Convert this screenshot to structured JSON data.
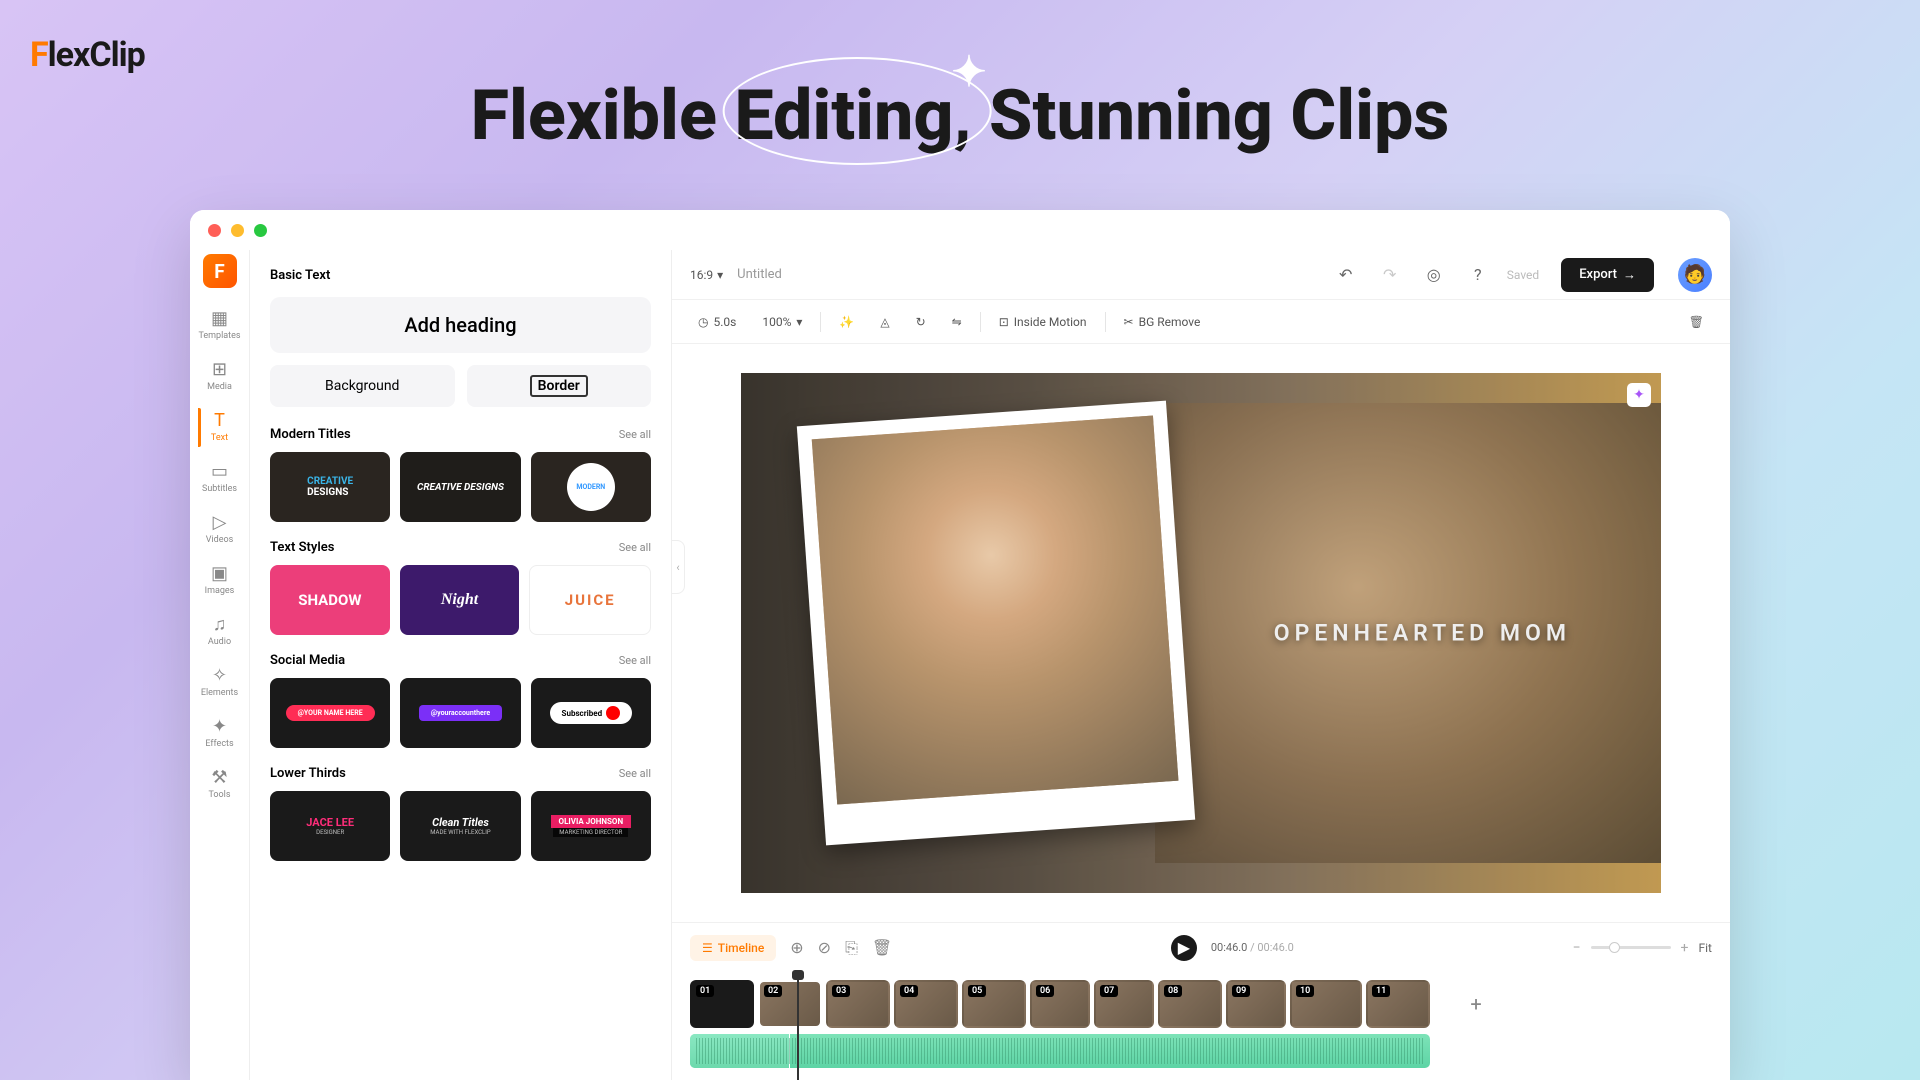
{
  "brand": "FlexClip",
  "hero": {
    "pre": "Flexible ",
    "em": "Editing,",
    "post": " Stunning Clips"
  },
  "side_nav": [
    {
      "key": "templates",
      "label": "Templates",
      "icon": "▦"
    },
    {
      "key": "media",
      "label": "Media",
      "icon": "⊞"
    },
    {
      "key": "text",
      "label": "Text",
      "icon": "T",
      "active": true
    },
    {
      "key": "subtitles",
      "label": "Subtitles",
      "icon": "▭"
    },
    {
      "key": "videos",
      "label": "Videos",
      "icon": "▷"
    },
    {
      "key": "images",
      "label": "Images",
      "icon": "▣"
    },
    {
      "key": "audio",
      "label": "Audio",
      "icon": "♫"
    },
    {
      "key": "elements",
      "label": "Elements",
      "icon": "✧"
    },
    {
      "key": "effects",
      "label": "Effects",
      "icon": "✦"
    },
    {
      "key": "tools",
      "label": "Tools",
      "icon": "⚒"
    }
  ],
  "panel": {
    "title": "Basic Text",
    "add_heading": "Add heading",
    "background": "Background",
    "border": "Border",
    "sections": {
      "modern": {
        "name": "Modern Titles",
        "see_all": "See all",
        "t1a": "CREATIVE",
        "t1b": "DESIGNS",
        "t2": "CREATIVE DESIGNS",
        "t3": "MODERN"
      },
      "styles": {
        "name": "Text Styles",
        "see_all": "See all",
        "t1": "SHADOW",
        "t2": "Night",
        "t3": "JUICE"
      },
      "social": {
        "name": "Social Media",
        "see_all": "See all",
        "t1": "@YOUR NAME HERE",
        "t2": "@youraccounthere",
        "t3": "Subscribed"
      },
      "lower": {
        "name": "Lower Thirds",
        "see_all": "See all",
        "t1n": "JACE LEE",
        "t1s": "DESIGNER",
        "t2n": "Clean Titles",
        "t2s": "MADE WITH FLEXCLIP",
        "t3n": "OLIVIA JOHNSON",
        "t3s": "MARKETING DIRECTOR"
      }
    }
  },
  "top": {
    "ratio": "16:9",
    "project": "Untitled",
    "saved": "Saved",
    "export": "Export"
  },
  "tools": {
    "duration": "5.0s",
    "zoom": "100%",
    "inside_motion": "Inside Motion",
    "bg_remove": "BG Remove"
  },
  "canvas_text": "OPENHEARTED MOM",
  "timeline": {
    "label": "Timeline",
    "current": "00:46.0",
    "total": "/ 00:46.0",
    "fit": "Fit",
    "clips": [
      "01",
      "02",
      "03",
      "04",
      "05",
      "06",
      "07",
      "08",
      "09",
      "10",
      "11"
    ]
  }
}
